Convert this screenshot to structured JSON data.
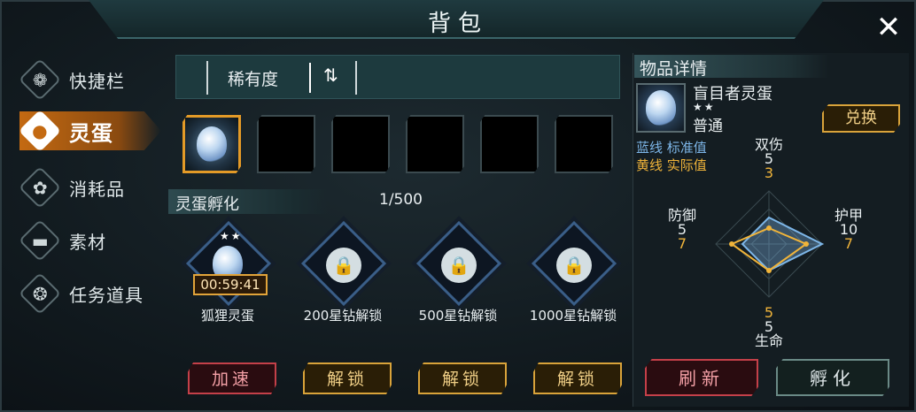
{
  "window": {
    "title": "背包",
    "close_icon": "close-icon"
  },
  "nav": [
    {
      "label": "快捷栏",
      "icon": "flower-icon",
      "glyph": "❁",
      "active": false
    },
    {
      "label": "灵蛋",
      "icon": "egg-icon",
      "glyph": "●",
      "active": true
    },
    {
      "label": "消耗品",
      "icon": "potion-icon",
      "glyph": "✿",
      "active": false
    },
    {
      "label": "素材",
      "icon": "material-icon",
      "glyph": "▬",
      "active": false
    },
    {
      "label": "任务道具",
      "icon": "quest-icon",
      "glyph": "❂",
      "active": false
    }
  ],
  "sort": {
    "label": "稀有度",
    "icon": "sort-icon",
    "glyph": "⇅"
  },
  "slots": [
    {
      "filled": true,
      "selected": true
    },
    {
      "filled": false
    },
    {
      "filled": false
    },
    {
      "filled": false
    },
    {
      "filled": false
    },
    {
      "filled": false
    }
  ],
  "incubator": {
    "title": "灵蛋孵化",
    "count": "1/500",
    "items": [
      {
        "name": "狐狸灵蛋",
        "stars": "★★",
        "timer": "00:59:41",
        "locked": false,
        "button": "加速",
        "button_style": "red"
      },
      {
        "name": "200星钻解锁",
        "locked": true,
        "button": "解锁",
        "button_style": "gold"
      },
      {
        "name": "500星钻解锁",
        "locked": true,
        "button": "解锁",
        "button_style": "gold"
      },
      {
        "name": "1000星钻解锁",
        "locked": true,
        "button": "解锁",
        "button_style": "gold"
      }
    ]
  },
  "detail": {
    "title": "物品详情",
    "name": "盲目者灵蛋",
    "stars": "★★",
    "rarity": "普通",
    "exchange": "兑换",
    "legend_blue": "蓝线 标准值",
    "legend_yellow": "黄线 实际值",
    "stats": [
      {
        "label": "双伤",
        "standard": 5,
        "actual": 3
      },
      {
        "label": "护甲",
        "standard": 10,
        "actual": 7
      },
      {
        "label": "生命",
        "standard": 5,
        "actual": 5
      },
      {
        "label": "防御",
        "standard": 5,
        "actual": 7
      }
    ],
    "refresh": "刷新",
    "hatch": "孵化",
    "colors": {
      "blue": "#7db6e8",
      "yellow": "#f0b43a",
      "red": "#c44049",
      "gold": "#d9a33a"
    }
  }
}
